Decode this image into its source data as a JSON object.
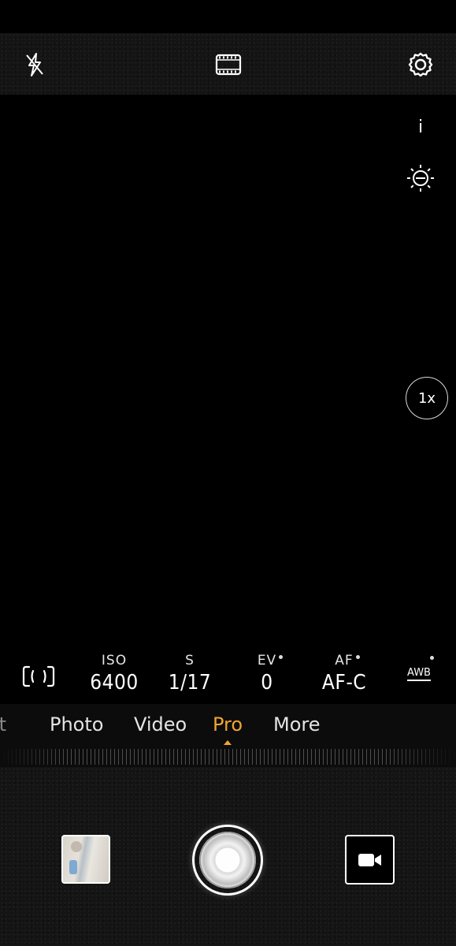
{
  "top_bar": {
    "icons": [
      "flash-off-icon",
      "filmstrip-icon",
      "settings-icon"
    ]
  },
  "side": {
    "info_label": "i",
    "zoom_label": "1x"
  },
  "pro_controls": {
    "iso": {
      "label": "ISO",
      "value": "6400"
    },
    "shutter": {
      "label": "S",
      "value": "1/17"
    },
    "ev": {
      "label": "EV",
      "value": "0"
    },
    "af": {
      "label": "AF",
      "value": "AF-C"
    },
    "wb": {
      "label": "AWB"
    }
  },
  "modes": {
    "items": [
      {
        "label": "it"
      },
      {
        "label": "Photo"
      },
      {
        "label": "Video"
      },
      {
        "label": "Pro"
      },
      {
        "label": "More"
      }
    ],
    "selected": "Pro",
    "accent_color": "#f0a532"
  }
}
